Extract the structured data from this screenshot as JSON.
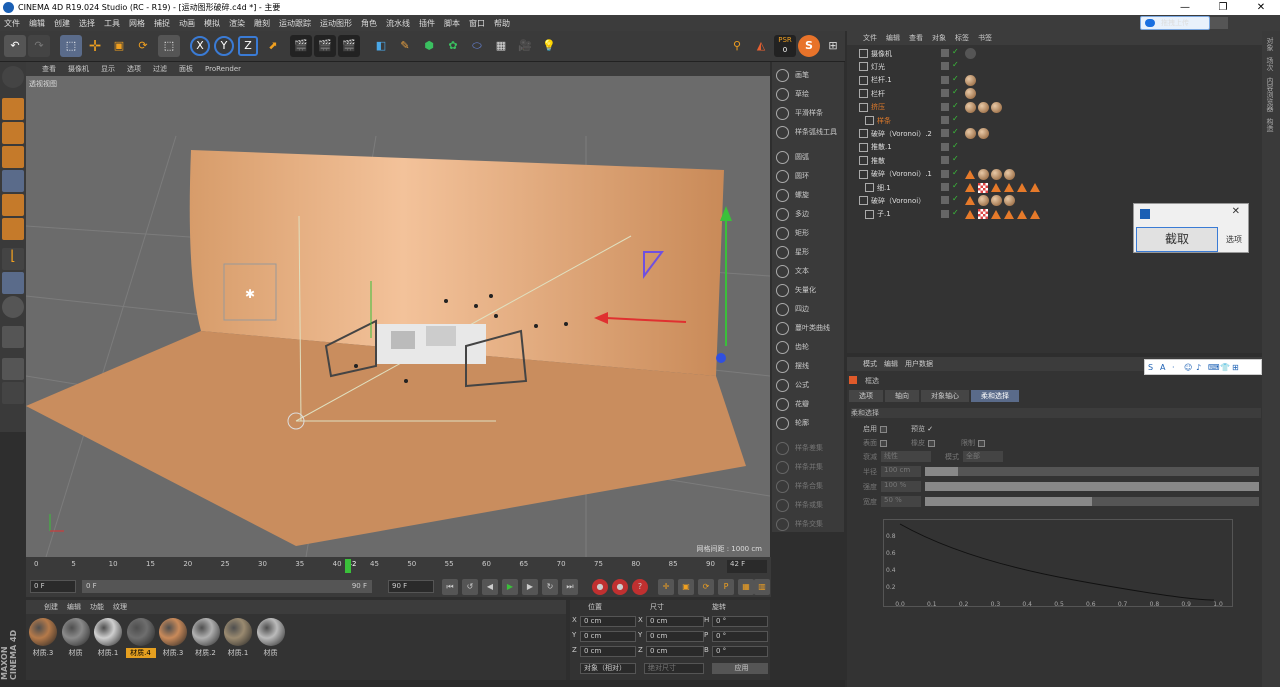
{
  "window": {
    "title": "CINEMA 4D R19.024 Studio (RC - R19) - [运动图形破碎.c4d *] - 主要",
    "controls": [
      "—",
      "❐",
      "✕"
    ]
  },
  "menu": {
    "items": [
      "文件",
      "编辑",
      "创建",
      "选择",
      "工具",
      "网格",
      "捕捉",
      "动画",
      "模拟",
      "渲染",
      "雕刻",
      "运动跟踪",
      "运动图形",
      "角色",
      "流水线",
      "插件",
      "脚本",
      "窗口",
      "帮助"
    ]
  },
  "upload_button": "拖拽上传",
  "toolbar": {
    "psr_label": "PSR",
    "psr_value": "0",
    "axis_x": "X",
    "axis_y": "Y",
    "axis_z": "Z"
  },
  "viewport": {
    "menu": [
      "查看",
      "摄像机",
      "显示",
      "选项",
      "过滤",
      "面板",
      "ProRender"
    ],
    "label": "透视视图",
    "grid_info": "网格间距 : 1000 cm"
  },
  "spline_tools": [
    {
      "label": "画笔",
      "enabled": true
    },
    {
      "label": "草绘",
      "enabled": true
    },
    {
      "label": "平滑样条",
      "enabled": true
    },
    {
      "label": "样条弧线工具",
      "enabled": true
    },
    {
      "label": "圆弧",
      "enabled": true
    },
    {
      "label": "圆环",
      "enabled": true
    },
    {
      "label": "螺旋",
      "enabled": true
    },
    {
      "label": "多边",
      "enabled": true
    },
    {
      "label": "矩形",
      "enabled": true
    },
    {
      "label": "星形",
      "enabled": true
    },
    {
      "label": "文本",
      "enabled": true
    },
    {
      "label": "矢量化",
      "enabled": true
    },
    {
      "label": "四边",
      "enabled": true
    },
    {
      "label": "蔓叶类曲线",
      "enabled": true
    },
    {
      "label": "齿轮",
      "enabled": true
    },
    {
      "label": "摆线",
      "enabled": true
    },
    {
      "label": "公式",
      "enabled": true
    },
    {
      "label": "花瓣",
      "enabled": true
    },
    {
      "label": "轮廓",
      "enabled": true
    },
    {
      "label": "样条差集",
      "enabled": false
    },
    {
      "label": "样条并集",
      "enabled": false
    },
    {
      "label": "样条合集",
      "enabled": false
    },
    {
      "label": "样条或集",
      "enabled": false
    },
    {
      "label": "样条交集",
      "enabled": false
    }
  ],
  "right_tabs": [
    "对象",
    "场次",
    "内容浏览器",
    "构造"
  ],
  "object_manager": {
    "menu": [
      "文件",
      "编辑",
      "查看",
      "对象",
      "标签",
      "书签"
    ],
    "objects": [
      {
        "name": "摄像机",
        "tags": [
          "cam"
        ]
      },
      {
        "name": "灯光",
        "tags": []
      },
      {
        "name": "栏杆.1",
        "tags": [
          "ball"
        ]
      },
      {
        "name": "栏杆",
        "tags": [
          "ball"
        ]
      },
      {
        "name": "挤压",
        "tags": [
          "ball",
          "ball",
          "ball"
        ],
        "highlight": true
      },
      {
        "name": "样条",
        "tags": [],
        "highlight": true,
        "child": true
      },
      {
        "name": "破碎（Voronoi）.2",
        "tags": [
          "ball",
          "ball"
        ]
      },
      {
        "name": "推散.1",
        "tags": []
      },
      {
        "name": "推散",
        "tags": []
      },
      {
        "name": "破碎（Voronoi）.1",
        "tags": [
          "tri",
          "ball",
          "ball",
          "ball"
        ]
      },
      {
        "name": "细.1",
        "tags": [
          "tri",
          "chk",
          "tri",
          "tri",
          "tri",
          "tri"
        ],
        "child": true
      },
      {
        "name": "破碎（Voronoi）",
        "tags": [
          "tri",
          "ball",
          "ball",
          "ball"
        ]
      },
      {
        "name": "子.1",
        "tags": [
          "tri",
          "chk",
          "tri",
          "tri",
          "tri",
          "tri"
        ],
        "child": true
      }
    ]
  },
  "attribute_manager": {
    "menu": [
      "模式",
      "编辑",
      "用户数据"
    ],
    "object_name": "框选",
    "tabs": [
      "选项",
      "轴向",
      "对象轴心",
      "柔和选择"
    ],
    "active_tab": "柔和选择",
    "section": "柔和选择",
    "fields": {
      "enable": "启用",
      "preview": "预览",
      "surface": "表面",
      "rubber": "橡皮",
      "limit": "限制",
      "falloff_label": "衰减",
      "falloff_value": "线性",
      "mode_label": "模式",
      "mode_value": "全部",
      "radius_label": "半径",
      "radius_value": "100 cm",
      "strength_label": "强度",
      "strength_value": "100 %",
      "width_label": "宽度",
      "width_value": "50 %"
    },
    "levels": {
      "radius": 0.1,
      "strength": 1.0,
      "width": 0.5
    },
    "graph": {
      "x_ticks": [
        "0.0",
        "0.1",
        "0.2",
        "0.3",
        "0.4",
        "0.5",
        "0.6",
        "0.7",
        "0.8",
        "0.9",
        "1.0"
      ],
      "y_ticks": [
        "0.8",
        "0.6",
        "0.4",
        "0.2"
      ]
    }
  },
  "ime_icons": [
    "S",
    "A",
    "·",
    "☺",
    "♪",
    "⌨",
    "👕",
    "⊞"
  ],
  "snip_tool": {
    "button": "截取",
    "options": "选项"
  },
  "timeline": {
    "ticks": [
      "0",
      "5",
      "10",
      "15",
      "20",
      "25",
      "30",
      "35",
      "40",
      "42",
      "45",
      "50",
      "55",
      "60",
      "65",
      "70",
      "75",
      "80",
      "85",
      "90"
    ],
    "current_frame": 42,
    "max_frame": 90,
    "end_label": "42 F"
  },
  "playbar": {
    "start": "0 F",
    "range_start": "0 F",
    "range_end": "90 F",
    "end": "90 F"
  },
  "material_manager": {
    "menu": [
      "创建",
      "编辑",
      "功能",
      "纹理"
    ],
    "materials": [
      {
        "name": "材质.3",
        "color": "#b57a4a"
      },
      {
        "name": "材质",
        "color": "#8a8a8a"
      },
      {
        "name": "材质.1",
        "color": "#cfcfcf"
      },
      {
        "name": "材质.4",
        "color": "#6e6e6e",
        "selected": true
      },
      {
        "name": "材质.3",
        "color": "#c98a5a"
      },
      {
        "name": "材质.2",
        "color": "#b0b0b0"
      },
      {
        "name": "材质.1",
        "color": "#9a8a70"
      },
      {
        "name": "材质",
        "color": "#bbbbbb"
      }
    ]
  },
  "coordinates": {
    "headers": [
      "位置",
      "尺寸",
      "旋转"
    ],
    "rows": [
      {
        "axis": "X",
        "pos": "0 cm",
        "size_axis": "X",
        "size": "0 cm",
        "rot_axis": "H",
        "rot": "0 °"
      },
      {
        "axis": "Y",
        "pos": "0 cm",
        "size_axis": "Y",
        "size": "0 cm",
        "rot_axis": "P",
        "rot": "0 °"
      },
      {
        "axis": "Z",
        "pos": "0 cm",
        "size_axis": "Z",
        "size": "0 cm",
        "rot_axis": "B",
        "rot": "0 °"
      }
    ],
    "mode": "对象（相对）",
    "size_mode": "绝对尺寸",
    "apply": "应用"
  },
  "brand": "MAXON CINEMA 4D",
  "colors": {
    "accent": "#e6a020",
    "highlight_orange": "#e07a2a",
    "select_blue": "#5a6b8a",
    "backdrop": "#e8a574"
  }
}
